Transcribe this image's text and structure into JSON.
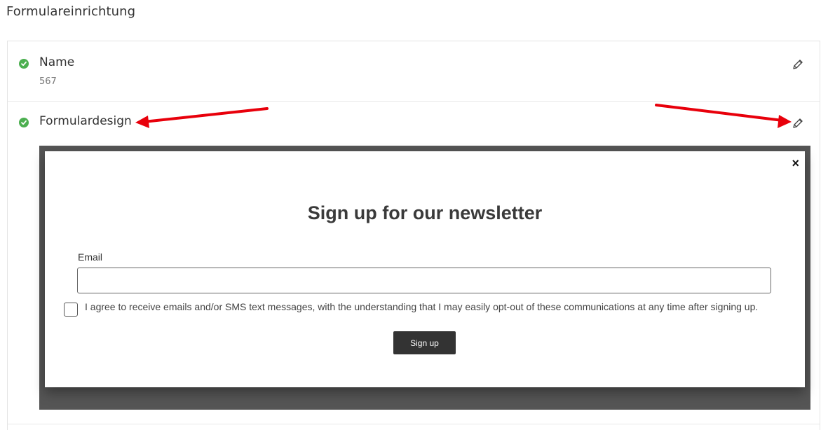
{
  "page": {
    "title": "Formulareinrichtung"
  },
  "sections": [
    {
      "title": "Name",
      "value": "567",
      "status": "complete",
      "edit_icon": "pencil-icon"
    },
    {
      "title": "Formulardesign",
      "status": "complete",
      "edit_icon": "pencil-icon"
    }
  ],
  "form_preview": {
    "close_glyph": "×",
    "heading": "Sign up for our newsletter",
    "email_label": "Email",
    "email_value": "",
    "consent_text": "I agree to receive emails and/or SMS text messages, with the understanding that I may easily opt-out of these communications at any time after signing up.",
    "consent_checked": false,
    "submit_label": "Sign up"
  },
  "colors": {
    "status_complete": "#4caf50",
    "annotation_arrow": "#e8000b",
    "preview_backdrop": "#555555",
    "submit_button": "#333333"
  }
}
